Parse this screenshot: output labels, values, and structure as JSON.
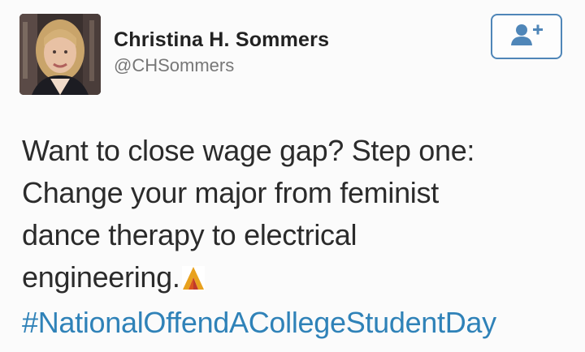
{
  "user": {
    "name": "Christina H. Sommers",
    "handle": "@CHSommers"
  },
  "follow_button": {
    "icon": "add-user-icon",
    "color": "#4f86b8"
  },
  "tweet": {
    "lines": [
      "Want to close wage gap? Step one:",
      "Change your major from feminist",
      "dance therapy to electrical",
      "engineering."
    ],
    "emoji": "watermark-logo-icon",
    "hashtag": "#NationalOffendACollegeStudentDay"
  },
  "colors": {
    "text": "#2b2b2b",
    "handle": "#777777",
    "hashtag": "#2f82b8"
  }
}
